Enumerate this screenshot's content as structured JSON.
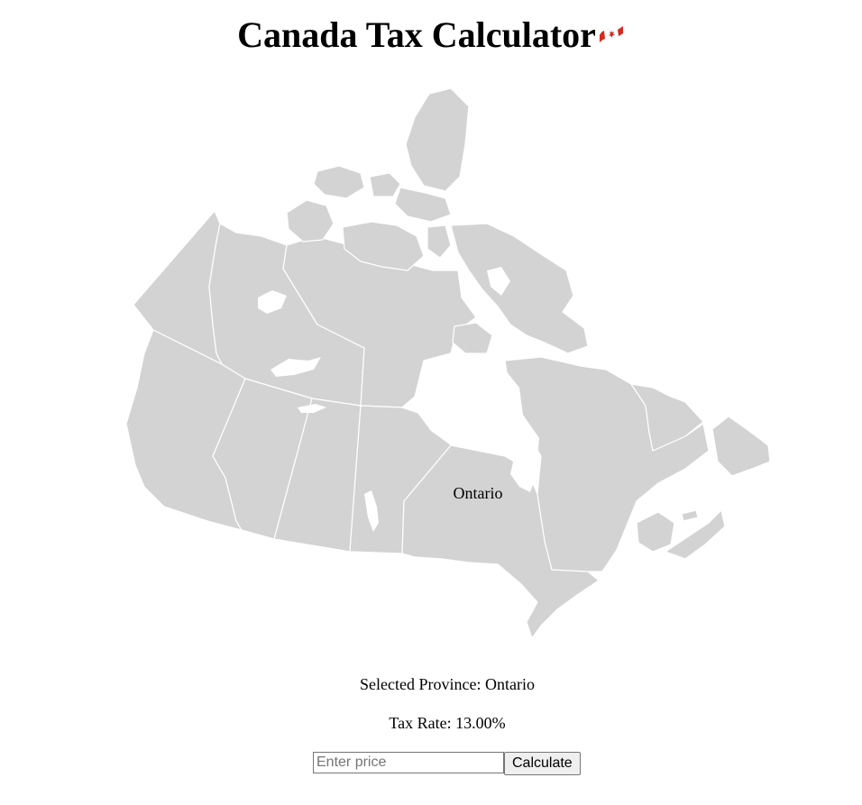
{
  "header": {
    "title": "Canada Tax Calculator",
    "flag_icon": "canada-flag-icon",
    "flag_color": "#d52b1e"
  },
  "map": {
    "province_fill": "#d3d3d3",
    "border_color": "#ffffff",
    "hover_label": "Ontario"
  },
  "selection": {
    "province_text": "Selected Province: Ontario",
    "tax_rate_text": "Tax Rate: 13.00%"
  },
  "calculator": {
    "price_value": "",
    "price_placeholder": "Enter price",
    "calculate_label": "Calculate"
  }
}
